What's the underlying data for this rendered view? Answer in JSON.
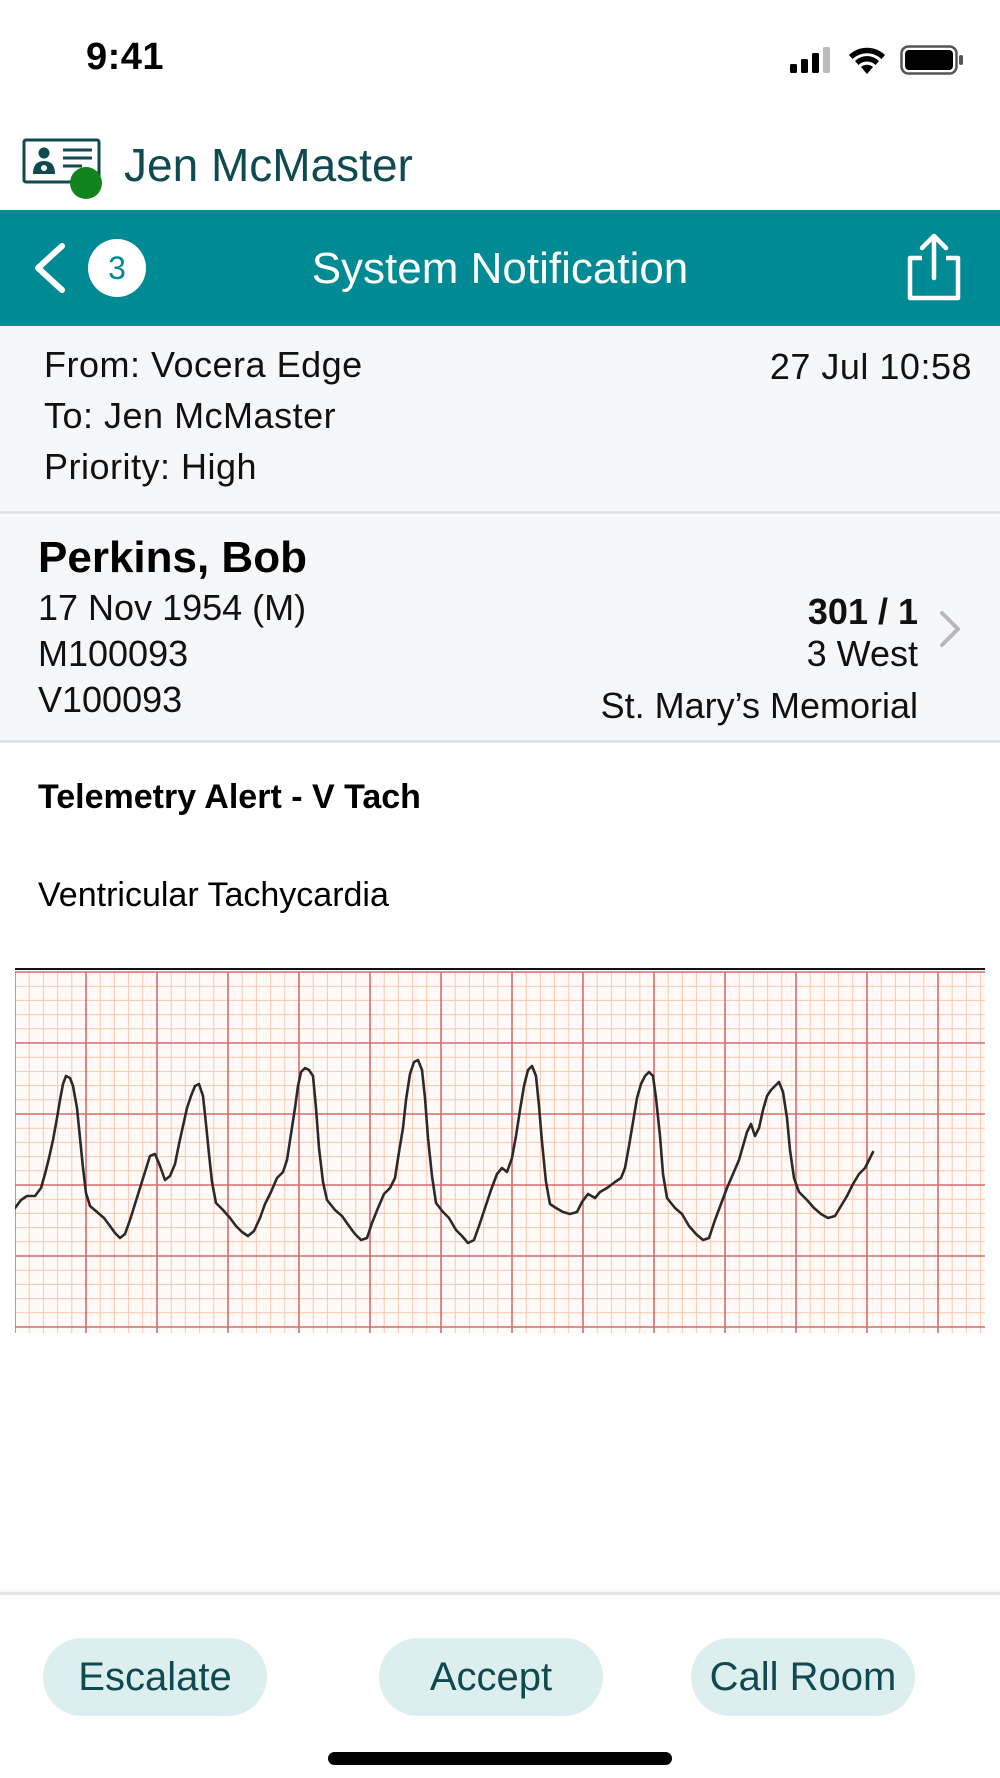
{
  "status_bar": {
    "time": "9:41",
    "icons": [
      "cellular-signal-icon",
      "wifi-icon",
      "battery-icon"
    ]
  },
  "user": {
    "name": "Jen McMaster",
    "avatar_icon": "id-card-icon",
    "presence": "online",
    "presence_color": "#12831d"
  },
  "nav": {
    "title": "System Notification",
    "badge_count": "3",
    "back_icon": "chevron-left-icon",
    "share_icon": "share-icon",
    "background_color": "#008a93"
  },
  "message": {
    "from": "From: Vocera Edge",
    "to": "To: Jen McMaster",
    "priority": "Priority: High",
    "date": "27 Jul 10:58"
  },
  "patient": {
    "name": "Perkins, Bob",
    "dob": "17 Nov 1954 (M)",
    "mrn": "M100093",
    "visit": "V100093",
    "room": "301 / 1",
    "unit": "3 West",
    "facility": "St. Mary’s Memorial"
  },
  "alert": {
    "title": "Telemetry Alert - V Tach",
    "description": "Ventricular Tachycardia"
  },
  "ecg_strip": {
    "grid_color_minor": "#f9c8ad",
    "grid_color_major": "#d56b6b",
    "trace_color": "#2a2a2a"
  },
  "actions": {
    "escalate": "Escalate",
    "accept": "Accept",
    "call_room": "Call Room",
    "button_color": "#ddeeee"
  }
}
